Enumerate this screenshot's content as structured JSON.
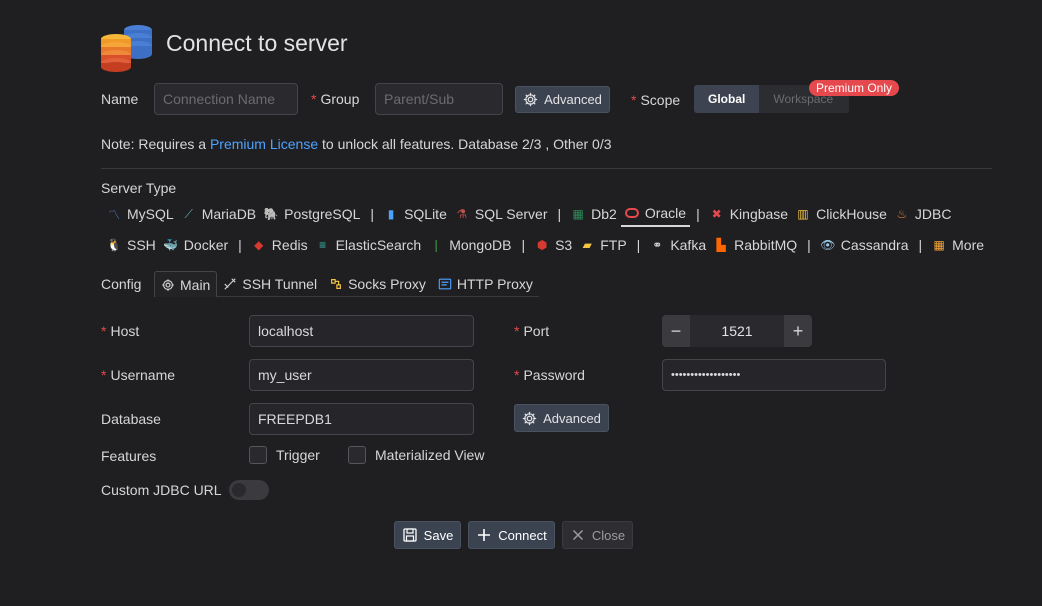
{
  "header": {
    "title": "Connect to server",
    "logo_icon": "database-stack-icon"
  },
  "top_row": {
    "name_label": "Name",
    "name_placeholder": "Connection Name",
    "group_label": "Group",
    "group_placeholder": "Parent/Sub",
    "advanced_label": "Advanced",
    "scope_label": "Scope",
    "scope_options": [
      "Global",
      "Workspace"
    ],
    "scope_selected": "Global",
    "premium_badge": "Premium Only"
  },
  "note": {
    "prefix": "Note: Requires a ",
    "link": "Premium License",
    "suffix": " to unlock all features. Database 2/3 , Other 0/3"
  },
  "server_type": {
    "label": "Server Type",
    "row1": [
      "MySQL",
      "MariaDB",
      "PostgreSQL",
      "SQLite",
      "SQL Server",
      "Db2",
      "Oracle",
      "Kingbase",
      "ClickHouse",
      "JDBC"
    ],
    "row2": [
      "SSH",
      "Docker",
      "Redis",
      "ElasticSearch",
      "MongoDB",
      "S3",
      "FTP",
      "Kafka",
      "RabbitMQ",
      "Cassandra",
      "More"
    ],
    "selected": "Oracle"
  },
  "config": {
    "label": "Config",
    "tabs": [
      "Main",
      "SSH Tunnel",
      "Socks Proxy",
      "HTTP Proxy"
    ],
    "active_tab": "Main"
  },
  "form": {
    "host_label": "Host",
    "host_value": "localhost",
    "port_label": "Port",
    "port_value": "1521",
    "username_label": "Username",
    "username_value": "my_user",
    "password_label": "Password",
    "password_value": "••••••••••••••••••",
    "database_label": "Database",
    "database_value": "FREEPDB1",
    "advanced_label": "Advanced",
    "features_label": "Features",
    "feature_trigger": "Trigger",
    "feature_materialized_view": "Materialized View",
    "custom_jdbc_label": "Custom JDBC URL"
  },
  "footer": {
    "save_label": "Save",
    "connect_label": "Connect",
    "close_label": "Close"
  },
  "colors": {
    "background": "#1f1f22",
    "required": "#e5484d",
    "link": "#4ea2ff",
    "badge": "#e5484d",
    "oracle": "#e5484d"
  }
}
